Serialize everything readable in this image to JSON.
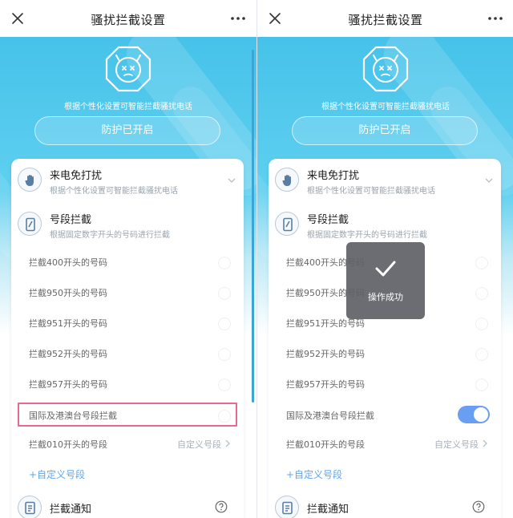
{
  "header": {
    "title": "骚扰拦截设置"
  },
  "hero": {
    "subtitle": "根据个性化设置可智能拦截骚扰电话",
    "protect_label": "防护已开启"
  },
  "sections": {
    "no_disturb": {
      "title": "来电免打扰",
      "subtitle": "根据个性化设置可智能拦截骚扰电话"
    },
    "prefix_block": {
      "title": "号段拦截",
      "subtitle": "根据固定数字开头的号码进行拦截"
    },
    "notify": {
      "title": "拦截通知"
    }
  },
  "rows": [
    {
      "label": "拦截400开头的号码"
    },
    {
      "label": "拦截950开头的号码"
    },
    {
      "label": "拦截951开头的号码"
    },
    {
      "label": "拦截952开头的号码"
    },
    {
      "label": "拦截957开头的号码"
    },
    {
      "label": "国际及港澳台号段拦截"
    }
  ],
  "panels": {
    "left": {
      "intl_toggle_on": false
    },
    "right": {
      "intl_toggle_on": true
    }
  },
  "custom_row": {
    "label": "拦截010开头的号段",
    "value": "自定义号段"
  },
  "add_custom": "+自定义号段",
  "toast": {
    "text": "操作成功"
  },
  "colors": {
    "accent": "#6a9ef2",
    "hero_top": "#46c2ea",
    "highlight": "#e86a8f"
  },
  "icons": [
    "close-icon",
    "more-icon",
    "shield-face-icon",
    "hand-icon",
    "phone-icon",
    "notice-icon",
    "help-icon",
    "chevron-down-icon",
    "chevron-right-icon",
    "check-icon"
  ]
}
